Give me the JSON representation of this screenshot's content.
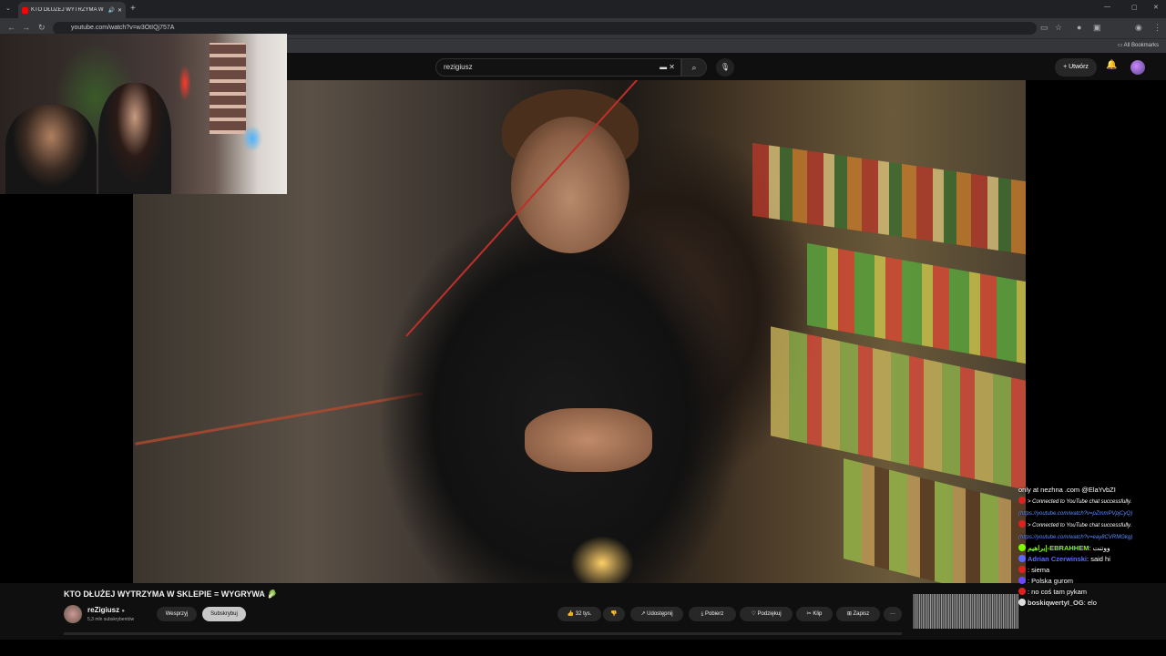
{
  "browser": {
    "tab_title": "KTO DŁUŻEJ WYTRZYMA W ",
    "url": "youtube.com/watch?v=w3OtIQj757A",
    "all_bookmarks": "All Bookmarks"
  },
  "youtube": {
    "search_value": "rezigiusz",
    "create_label": "Utwórz",
    "video_title": "KTO DŁUŻEJ WYTRZYMA W SKLEPIE = WYGRYWA 🥬",
    "channel_name": "reZigiusz",
    "channel_subs": "5,3 mln subskrybentów",
    "support_label": "Wesprzyj",
    "subscribe_label": "Subskrybuj",
    "likes": "32 tys.",
    "share_label": "Udostępnij",
    "download_label": "Pobierz",
    "thanks_label": "Podziękuj",
    "clip_label": "Klip",
    "save_label": "Zapisz",
    "more_label": "···"
  },
  "chat": {
    "messages": [
      {
        "user": "",
        "text": "only at nezhna .com @ElaYvbZI",
        "type": "text"
      },
      {
        "user": "",
        "text": "> Connected to YouTube chat successfully.",
        "type": "sys"
      },
      {
        "user": "",
        "text": "(https://youtube.com/watch?v=pZmmPVpjCyQ)",
        "type": "link"
      },
      {
        "user": "",
        "text": "> Connected to YouTube chat successfully.",
        "type": "sys"
      },
      {
        "user": "",
        "text": "(https://youtube.com/watch?v=eay8CVRMGkg)",
        "type": "link"
      },
      {
        "user": "إبراهيم-EBRAHHEM",
        "text": "ووتنت",
        "type": "user",
        "color": "#7CFC00"
      },
      {
        "user": "Adrian Czerwinski",
        "text": "said hi",
        "type": "user",
        "color": "#5a6cff"
      },
      {
        "user": "",
        "text": "siema",
        "type": "user",
        "color": "#d22"
      },
      {
        "user": "",
        "text": "Polska gurom",
        "type": "user",
        "color": "#6a4aff"
      },
      {
        "user": "",
        "text": "no coś tam pykam",
        "type": "user",
        "color": "#d22"
      },
      {
        "user": "boskiqwertyI_OG",
        "text": "elo",
        "type": "user",
        "color": "#ddd"
      }
    ]
  },
  "colors": {
    "yt_bg": "#0f0f0f",
    "chrome_bg": "#202124",
    "accent": "#ff0000"
  }
}
